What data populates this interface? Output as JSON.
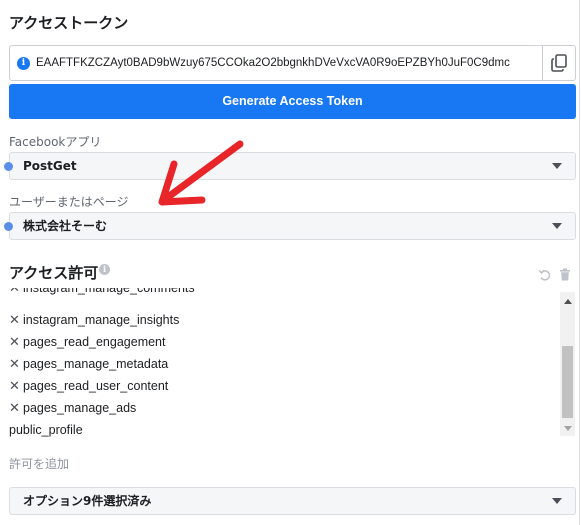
{
  "token": {
    "title": "アクセストークン",
    "value": "EAAFTFKZCZAyt0BAD9bWzuy675CCOka2O2bbgnkhDVeVxcVA0R9oEPZBYh0JuF0C9dmc",
    "info_icon": "info-icon",
    "copy_icon": "copy-icon",
    "generate_label": "Generate Access Token",
    "accent": "#1877f2"
  },
  "app": {
    "label": "Facebookアプリ",
    "selected": "PostGet"
  },
  "user": {
    "label": "ユーザーまたはページ",
    "selected": "株式会社そーむ"
  },
  "permissions": {
    "title": "アクセス許可",
    "items": [
      {
        "label": "instagram_manage_comments",
        "removable": true
      },
      {
        "label": "instagram_manage_insights",
        "removable": true
      },
      {
        "label": "pages_read_engagement",
        "removable": true
      },
      {
        "label": "pages_manage_metadata",
        "removable": true
      },
      {
        "label": "pages_read_user_content",
        "removable": true
      },
      {
        "label": "pages_manage_ads",
        "removable": true
      },
      {
        "label": "public_profile",
        "removable": false
      }
    ],
    "add_placeholder": "許可を追加",
    "options_selected": "オプション9件選択済み"
  },
  "annotation": {
    "arrow_color": "#e8262a"
  }
}
